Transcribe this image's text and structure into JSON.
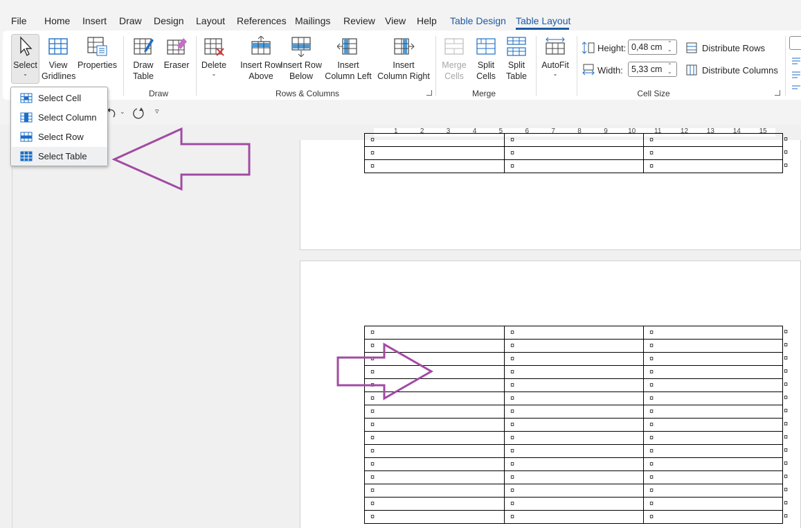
{
  "menu": {
    "tabs": [
      "File",
      "Home",
      "Insert",
      "Draw",
      "Design",
      "Layout",
      "References",
      "Mailings",
      "Review",
      "View",
      "Help",
      "Table Design",
      "Table Layout"
    ],
    "active_tab": "Table Layout"
  },
  "ribbon": {
    "table_group": {
      "select": "Select",
      "view_gridlines": [
        "View",
        "Gridlines"
      ],
      "properties": "Properties"
    },
    "draw_group": {
      "label": "Draw",
      "draw_table": [
        "Draw",
        "Table"
      ],
      "eraser": "Eraser"
    },
    "rows_columns": {
      "label": "Rows & Columns",
      "delete": "Delete",
      "insert_above": [
        "Insert Row",
        "Above"
      ],
      "insert_below": [
        "Insert Row",
        "Below"
      ],
      "insert_left": [
        "Insert",
        "Column Left"
      ],
      "insert_right": [
        "Insert",
        "Column Right"
      ]
    },
    "merge": {
      "label": "Merge",
      "merge_cells": [
        "Merge",
        "Cells"
      ],
      "split_cells": [
        "Split",
        "Cells"
      ],
      "split_table": [
        "Split",
        "Table"
      ]
    },
    "autofit": "AutoFit",
    "cell_size": {
      "label": "Cell Size",
      "height_label": "Height:",
      "height_value": "0,48 cm",
      "width_label": "Width:",
      "width_value": "5,33 cm",
      "distribute_rows": "Distribute Rows",
      "distribute_columns": "Distribute Columns"
    }
  },
  "select_menu": {
    "items": [
      "Select Cell",
      "Select Column",
      "Select Row",
      "Select Table"
    ],
    "highlighted": "Select Table"
  },
  "ruler": {
    "numbers": [
      "1",
      "2",
      "3",
      "4",
      "5",
      "6",
      "7",
      "8",
      "9",
      "10",
      "11",
      "12",
      "13",
      "14",
      "15"
    ]
  },
  "document": {
    "cell_mark": "¤",
    "top_table_rows": 3,
    "bottom_table_rows": 15,
    "columns": 3
  },
  "colors": {
    "accent": "#1c5aa5",
    "arrow": "#a14ba3"
  }
}
